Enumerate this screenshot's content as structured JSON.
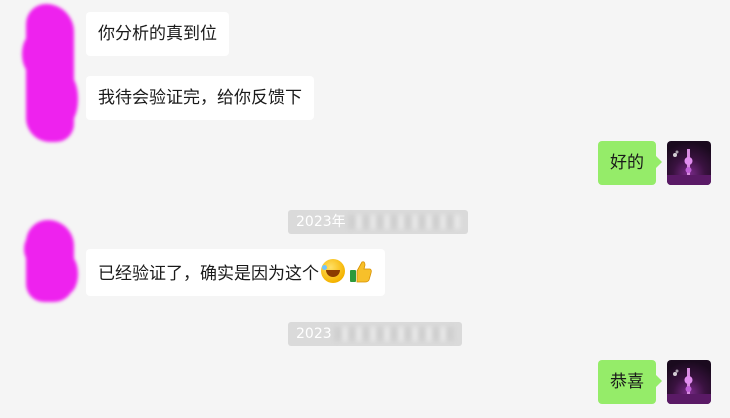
{
  "messages": {
    "m1": "你分析的真到位",
    "m2": "我待会验证完，给你反馈下",
    "m3": "好的",
    "m4": "已经验证了，确实是因为这个",
    "m5": "恭喜"
  },
  "timestamps": {
    "t1": "2023年",
    "t2": "2023"
  },
  "icons": {
    "laugh": "rolling-on-floor-laughing-emoji",
    "thumb": "thumbs-up-emoji"
  },
  "colors": {
    "background": "#f5f5f5",
    "incoming_bubble": "#ffffff",
    "outgoing_bubble": "#95ec69",
    "redaction": "#ee22ee"
  }
}
